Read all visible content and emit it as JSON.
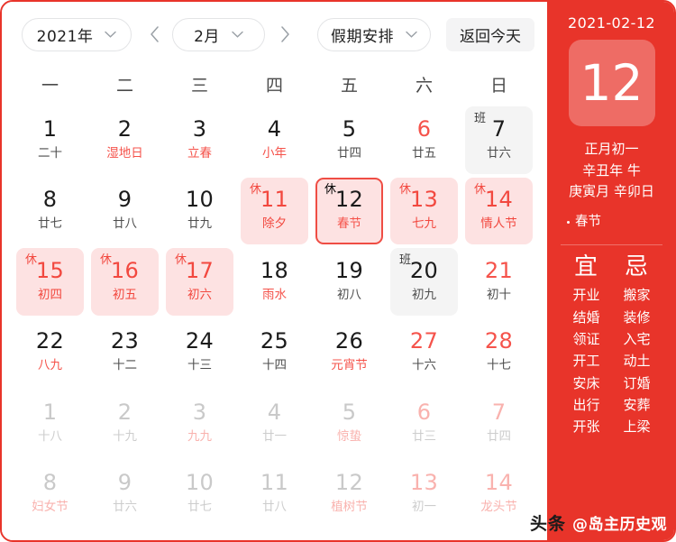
{
  "toolbar": {
    "year_label": "2021年",
    "month_label": "2月",
    "holiday_label": "假期安排",
    "today_label": "返回今天",
    "prev_icon": "chevron-left-icon",
    "next_icon": "chevron-right-icon",
    "dropdown_icon": "chevron-down-icon"
  },
  "weekdays": [
    "一",
    "二",
    "三",
    "四",
    "五",
    "六",
    "日"
  ],
  "grid": [
    {
      "day": "1",
      "lunar": "二十",
      "badge": "",
      "state": "normal",
      "lunar_red": false,
      "weekend": false
    },
    {
      "day": "2",
      "lunar": "湿地日",
      "badge": "",
      "state": "normal",
      "lunar_red": true,
      "weekend": false
    },
    {
      "day": "3",
      "lunar": "立春",
      "badge": "",
      "state": "normal",
      "lunar_red": true,
      "weekend": false
    },
    {
      "day": "4",
      "lunar": "小年",
      "badge": "",
      "state": "normal",
      "lunar_red": true,
      "weekend": false
    },
    {
      "day": "5",
      "lunar": "廿四",
      "badge": "",
      "state": "normal",
      "lunar_red": false,
      "weekend": false
    },
    {
      "day": "6",
      "lunar": "廿五",
      "badge": "",
      "state": "normal",
      "lunar_red": false,
      "weekend": true
    },
    {
      "day": "7",
      "lunar": "廿六",
      "badge": "班",
      "state": "work",
      "lunar_red": false,
      "weekend": false
    },
    {
      "day": "8",
      "lunar": "廿七",
      "badge": "",
      "state": "normal",
      "lunar_red": false,
      "weekend": false
    },
    {
      "day": "9",
      "lunar": "廿八",
      "badge": "",
      "state": "normal",
      "lunar_red": false,
      "weekend": false
    },
    {
      "day": "10",
      "lunar": "廿九",
      "badge": "",
      "state": "normal",
      "lunar_red": false,
      "weekend": false
    },
    {
      "day": "11",
      "lunar": "除夕",
      "badge": "休",
      "state": "rest",
      "lunar_red": true,
      "weekend": false
    },
    {
      "day": "12",
      "lunar": "春节",
      "badge": "休",
      "state": "selected",
      "lunar_red": true,
      "weekend": false
    },
    {
      "day": "13",
      "lunar": "七九",
      "badge": "休",
      "state": "rest",
      "lunar_red": true,
      "weekend": true
    },
    {
      "day": "14",
      "lunar": "情人节",
      "badge": "休",
      "state": "rest",
      "lunar_red": true,
      "weekend": false
    },
    {
      "day": "15",
      "lunar": "初四",
      "badge": "休",
      "state": "rest",
      "lunar_red": true,
      "weekend": false
    },
    {
      "day": "16",
      "lunar": "初五",
      "badge": "休",
      "state": "rest",
      "lunar_red": true,
      "weekend": false
    },
    {
      "day": "17",
      "lunar": "初六",
      "badge": "休",
      "state": "rest",
      "lunar_red": true,
      "weekend": false
    },
    {
      "day": "18",
      "lunar": "雨水",
      "badge": "",
      "state": "normal",
      "lunar_red": true,
      "weekend": false
    },
    {
      "day": "19",
      "lunar": "初八",
      "badge": "",
      "state": "normal",
      "lunar_red": false,
      "weekend": false
    },
    {
      "day": "20",
      "lunar": "初九",
      "badge": "班",
      "state": "work",
      "lunar_red": false,
      "weekend": false
    },
    {
      "day": "21",
      "lunar": "初十",
      "badge": "",
      "state": "normal",
      "lunar_red": false,
      "weekend": true
    },
    {
      "day": "22",
      "lunar": "八九",
      "badge": "",
      "state": "normal",
      "lunar_red": true,
      "weekend": false
    },
    {
      "day": "23",
      "lunar": "十二",
      "badge": "",
      "state": "normal",
      "lunar_red": false,
      "weekend": false
    },
    {
      "day": "24",
      "lunar": "十三",
      "badge": "",
      "state": "normal",
      "lunar_red": false,
      "weekend": false
    },
    {
      "day": "25",
      "lunar": "十四",
      "badge": "",
      "state": "normal",
      "lunar_red": false,
      "weekend": false
    },
    {
      "day": "26",
      "lunar": "元宵节",
      "badge": "",
      "state": "normal",
      "lunar_red": true,
      "weekend": false
    },
    {
      "day": "27",
      "lunar": "十六",
      "badge": "",
      "state": "normal",
      "lunar_red": false,
      "weekend": true
    },
    {
      "day": "28",
      "lunar": "十七",
      "badge": "",
      "state": "normal",
      "lunar_red": false,
      "weekend": true
    },
    {
      "day": "1",
      "lunar": "十八",
      "badge": "",
      "state": "other",
      "lunar_red": false,
      "weekend": false
    },
    {
      "day": "2",
      "lunar": "十九",
      "badge": "",
      "state": "other",
      "lunar_red": false,
      "weekend": false
    },
    {
      "day": "3",
      "lunar": "九九",
      "badge": "",
      "state": "other",
      "lunar_red": true,
      "weekend": false
    },
    {
      "day": "4",
      "lunar": "廿一",
      "badge": "",
      "state": "other",
      "lunar_red": false,
      "weekend": false
    },
    {
      "day": "5",
      "lunar": "惊蛰",
      "badge": "",
      "state": "other",
      "lunar_red": true,
      "weekend": false
    },
    {
      "day": "6",
      "lunar": "廿三",
      "badge": "",
      "state": "other",
      "lunar_red": false,
      "weekend": true
    },
    {
      "day": "7",
      "lunar": "廿四",
      "badge": "",
      "state": "other",
      "lunar_red": false,
      "weekend": true
    },
    {
      "day": "8",
      "lunar": "妇女节",
      "badge": "",
      "state": "other",
      "lunar_red": true,
      "weekend": false
    },
    {
      "day": "9",
      "lunar": "廿六",
      "badge": "",
      "state": "other",
      "lunar_red": false,
      "weekend": false
    },
    {
      "day": "10",
      "lunar": "廿七",
      "badge": "",
      "state": "other",
      "lunar_red": false,
      "weekend": false
    },
    {
      "day": "11",
      "lunar": "廿八",
      "badge": "",
      "state": "other",
      "lunar_red": false,
      "weekend": false
    },
    {
      "day": "12",
      "lunar": "植树节",
      "badge": "",
      "state": "other",
      "lunar_red": true,
      "weekend": false
    },
    {
      "day": "13",
      "lunar": "初一",
      "badge": "",
      "state": "other",
      "lunar_red": false,
      "weekend": true
    },
    {
      "day": "14",
      "lunar": "龙头节",
      "badge": "",
      "state": "other",
      "lunar_red": true,
      "weekend": true
    }
  ],
  "sidebar": {
    "date": "2021-02-12",
    "big_day": "12",
    "lunar_lines": [
      "正月初一",
      "辛丑年 牛",
      "庚寅月 辛卯日"
    ],
    "festivals": [
      "春节"
    ],
    "yi_head": "宜",
    "ji_head": "忌",
    "yi_items": [
      "开业",
      "结婚",
      "领证",
      "开工",
      "安床",
      "出行",
      "开张"
    ],
    "ji_items": [
      "搬家",
      "装修",
      "入宅",
      "动土",
      "订婚",
      "安葬",
      "上梁"
    ]
  },
  "watermark": {
    "platform": "头条",
    "account": "@岛主历史观"
  },
  "colors": {
    "brand_red": "#e8342a",
    "accent_red": "#f5534b",
    "rest_bg": "#fde2e2",
    "work_bg": "#f4f4f4"
  }
}
